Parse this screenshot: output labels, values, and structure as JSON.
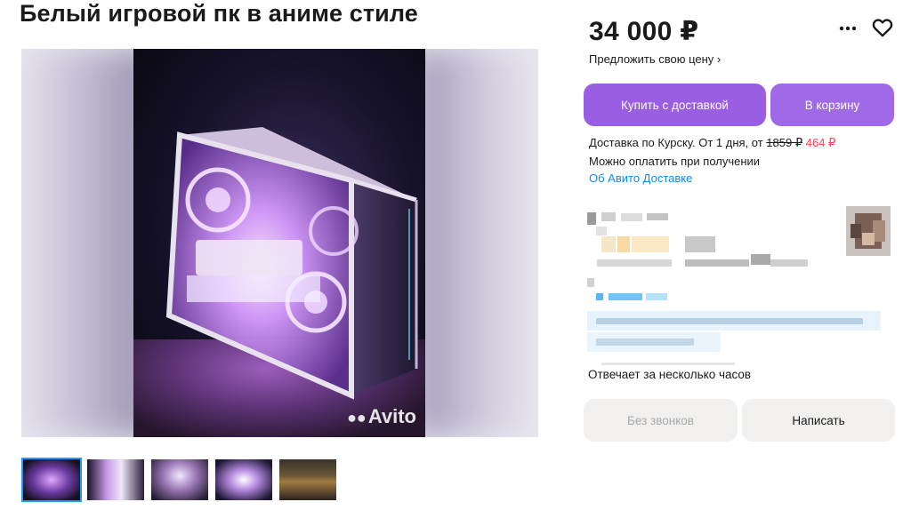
{
  "listing": {
    "title": "Белый игровой пк в аниме стиле",
    "watermark": "Avito"
  },
  "thumbnails": [
    {
      "name": "thumb-1",
      "active": true
    },
    {
      "name": "thumb-2",
      "active": false
    },
    {
      "name": "thumb-3",
      "active": false
    },
    {
      "name": "thumb-4",
      "active": false
    },
    {
      "name": "thumb-5",
      "active": false
    }
  ],
  "price": {
    "value": "34 000 ₽",
    "offer_label": "Предложить свою цену ›"
  },
  "actions": {
    "buy_label": "Купить с доставкой",
    "cart_label": "В корзину",
    "more_icon": "more-icon",
    "favorite_icon": "heart-icon"
  },
  "delivery": {
    "prefix": "Доставка по Курску. От 1 дня, от ",
    "old_price": "1859 ₽",
    "new_price": "464 ₽",
    "payment": "Можно оплатить при получении",
    "link": "Об Авито Доставке"
  },
  "seller": {
    "reply_time": "Отвечает за несколько часов"
  },
  "contact": {
    "no_calls_label": "Без звонков",
    "write_label": "Написать"
  },
  "colors": {
    "accent": "#9a5ee2",
    "link": "#0a8cf0",
    "price_red": "#ff4053",
    "secondary_button": "#f1f0ef"
  }
}
